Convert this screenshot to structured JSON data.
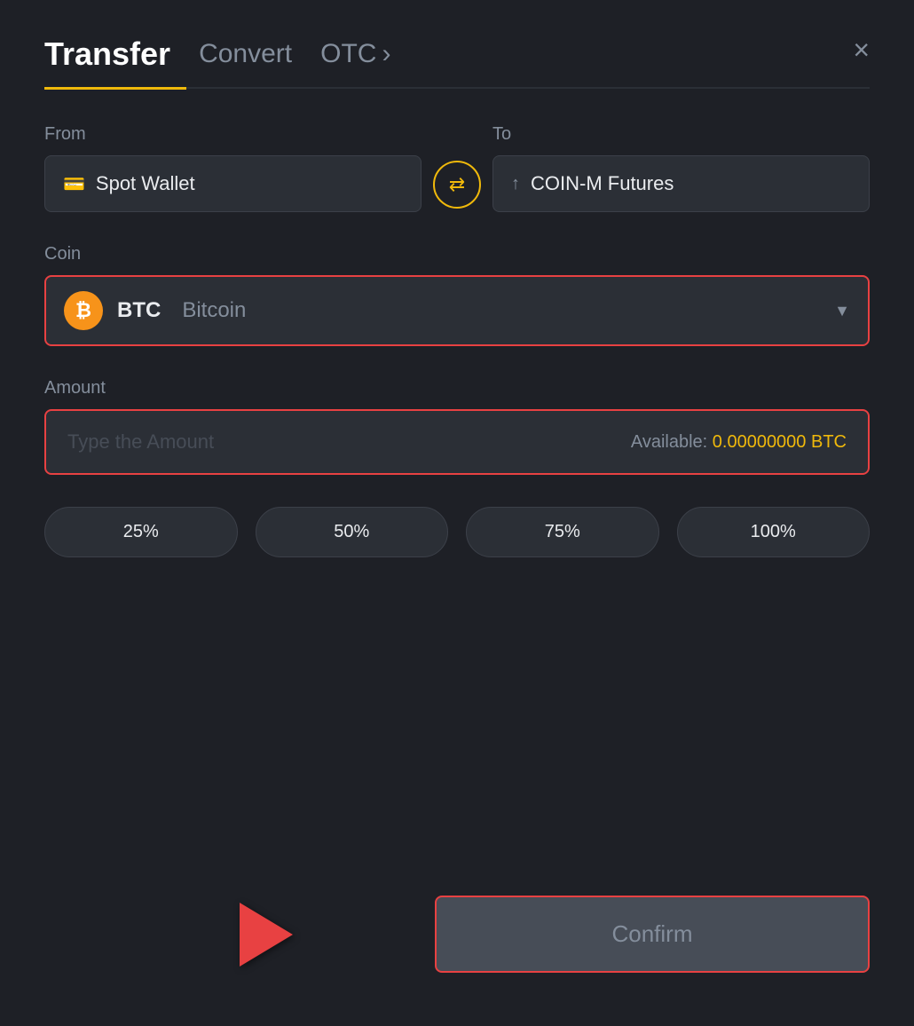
{
  "header": {
    "tab_transfer": "Transfer",
    "tab_convert": "Convert",
    "tab_otc": "OTC",
    "otc_chevron": "›",
    "close_label": "×"
  },
  "from": {
    "label": "From",
    "wallet_icon": "▬",
    "wallet_name": "Spot Wallet"
  },
  "to": {
    "label": "To",
    "wallet_icon": "↑",
    "wallet_name": "COIN-M Futures"
  },
  "swap": {
    "icon": "⇄"
  },
  "coin": {
    "label": "Coin",
    "symbol": "BTC",
    "name": "Bitcoin",
    "chevron": "▼"
  },
  "amount": {
    "label": "Amount",
    "placeholder": "Type the Amount",
    "available_label": "Available:",
    "available_value": "0.00000000 BTC"
  },
  "percentages": [
    {
      "label": "25%"
    },
    {
      "label": "50%"
    },
    {
      "label": "75%"
    },
    {
      "label": "100%"
    }
  ],
  "confirm_button": "Confirm"
}
